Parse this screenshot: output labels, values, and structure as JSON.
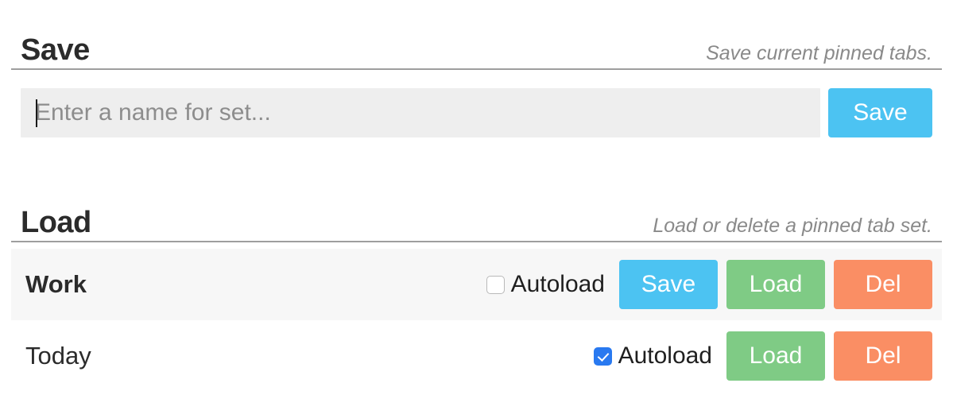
{
  "save": {
    "title": "Save",
    "description": "Save current pinned tabs.",
    "input_value": "",
    "input_placeholder": "Enter a name for set...",
    "submit_label": "Save"
  },
  "load": {
    "title": "Load",
    "description": "Load or delete a pinned tab set.",
    "autoload_label": "Autoload",
    "sets": [
      {
        "name": "Work",
        "autoload": false,
        "save_label": "Save",
        "load_label": "Load",
        "delete_label": "Del"
      },
      {
        "name": "Today",
        "autoload": true,
        "load_label": "Load",
        "delete_label": "Del"
      }
    ]
  },
  "colors": {
    "blue": "#4cc3f2",
    "green": "#7fcb85",
    "red": "#fa8e64",
    "checkbox_on": "#2979f0",
    "rule": "#9e9e9e",
    "row_alt": "#f7f7f7",
    "input_bg": "#eeeeee"
  }
}
